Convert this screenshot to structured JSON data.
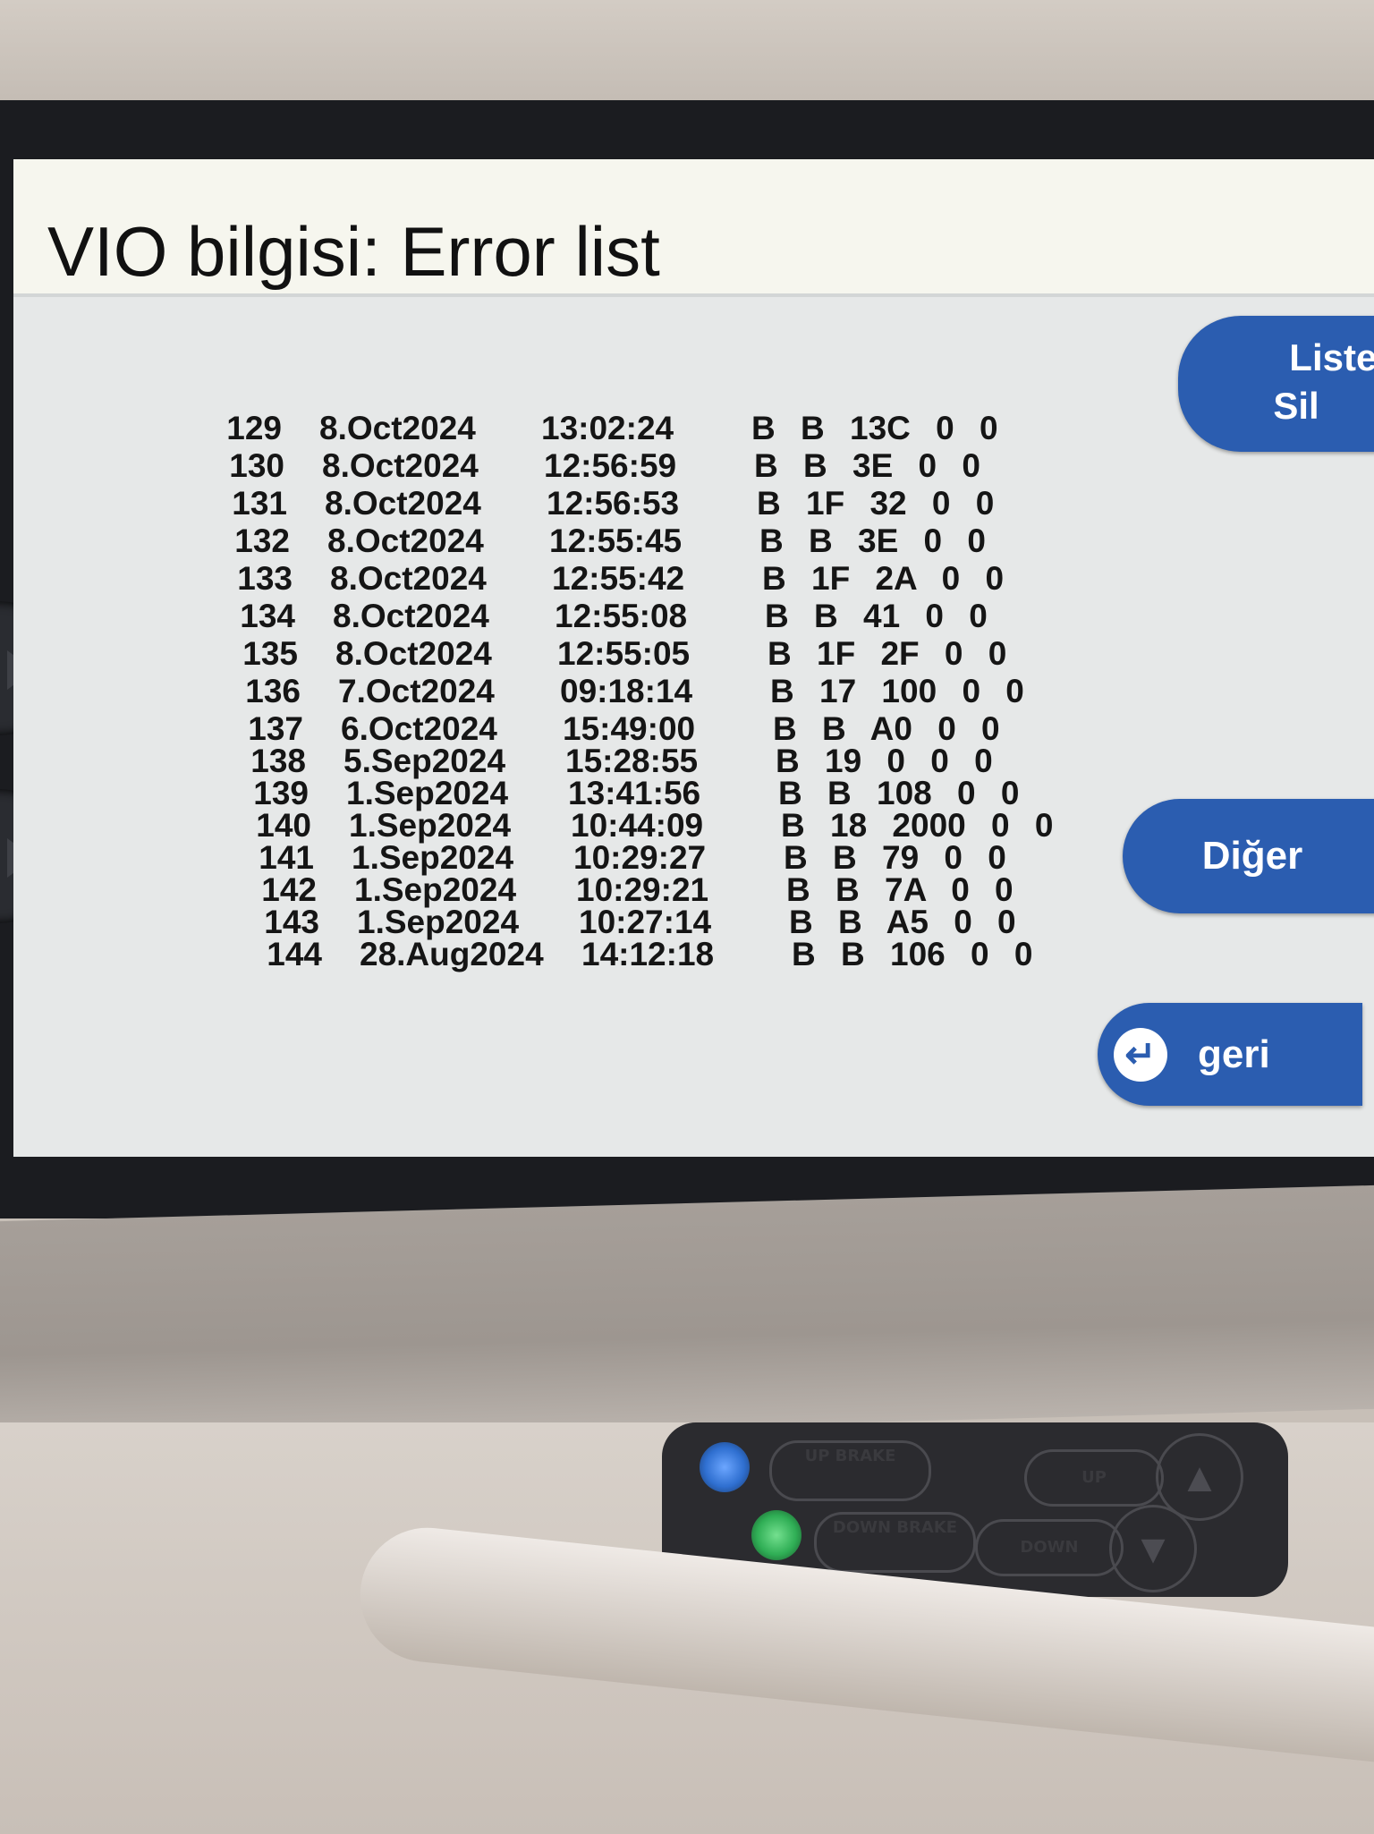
{
  "screen": {
    "title": "VIO bilgisi: Error list"
  },
  "error_list": {
    "rows": [
      {
        "no": "129",
        "date": "8.Oct2024",
        "time": "13:02:24",
        "codes": "B B 13C 0 0"
      },
      {
        "no": "130",
        "date": "8.Oct2024",
        "time": "12:56:59",
        "codes": "B B 3E 0 0"
      },
      {
        "no": "131",
        "date": "8.Oct2024",
        "time": "12:56:53",
        "codes": "B 1F 32 0 0"
      },
      {
        "no": "132",
        "date": "8.Oct2024",
        "time": "12:55:45",
        "codes": "B B 3E 0 0"
      },
      {
        "no": "133",
        "date": "8.Oct2024",
        "time": "12:55:42",
        "codes": "B 1F 2A 0 0"
      },
      {
        "no": "134",
        "date": "8.Oct2024",
        "time": "12:55:08",
        "codes": "B B 41 0 0"
      },
      {
        "no": "135",
        "date": "8.Oct2024",
        "time": "12:55:05",
        "codes": "B 1F 2F 0 0"
      },
      {
        "no": "136",
        "date": "7.Oct2024",
        "time": "09:18:14",
        "codes": "B 17 100 0 0"
      },
      {
        "no": "137",
        "date": "6.Oct2024",
        "time": "15:49:00",
        "codes": "B B A0 0 0"
      },
      {
        "no": "138",
        "date": "5.Sep2024",
        "time": "15:28:55",
        "codes": "B 19 0 0 0"
      },
      {
        "no": "139",
        "date": "1.Sep2024",
        "time": "13:41:56",
        "codes": "B B 108 0 0"
      },
      {
        "no": "140",
        "date": "1.Sep2024",
        "time": "10:44:09",
        "codes": "B 18 2000 0 0"
      },
      {
        "no": "141",
        "date": "1.Sep2024",
        "time": "10:29:27",
        "codes": "B B 79 0 0"
      },
      {
        "no": "142",
        "date": "1.Sep2024",
        "time": "10:29:21",
        "codes": "B B 7A 0 0"
      },
      {
        "no": "143",
        "date": "1.Sep2024",
        "time": "10:27:14",
        "codes": "B B A5 0 0"
      },
      {
        "no": "144",
        "date": "28.Aug2024",
        "time": "14:12:18",
        "codes": "B B 106 0 0"
      }
    ]
  },
  "actions": {
    "listele_line1": "Listel",
    "listele_line2": "Sil",
    "diger": "Diğer",
    "geri": "geri",
    "geri_icon": "return-arrow-icon"
  },
  "control_panel": {
    "up_brake": "UP BRAKE",
    "down_brake": "DOWN BRAKE",
    "up": "UP",
    "down": "DOWN",
    "led_up_color": "#2f6fd0",
    "led_down_color": "#2fae55"
  },
  "colors": {
    "button_blue": "#2b5db0",
    "screen_bg": "#e6e8e8",
    "title_bg": "#f6f6ee"
  }
}
